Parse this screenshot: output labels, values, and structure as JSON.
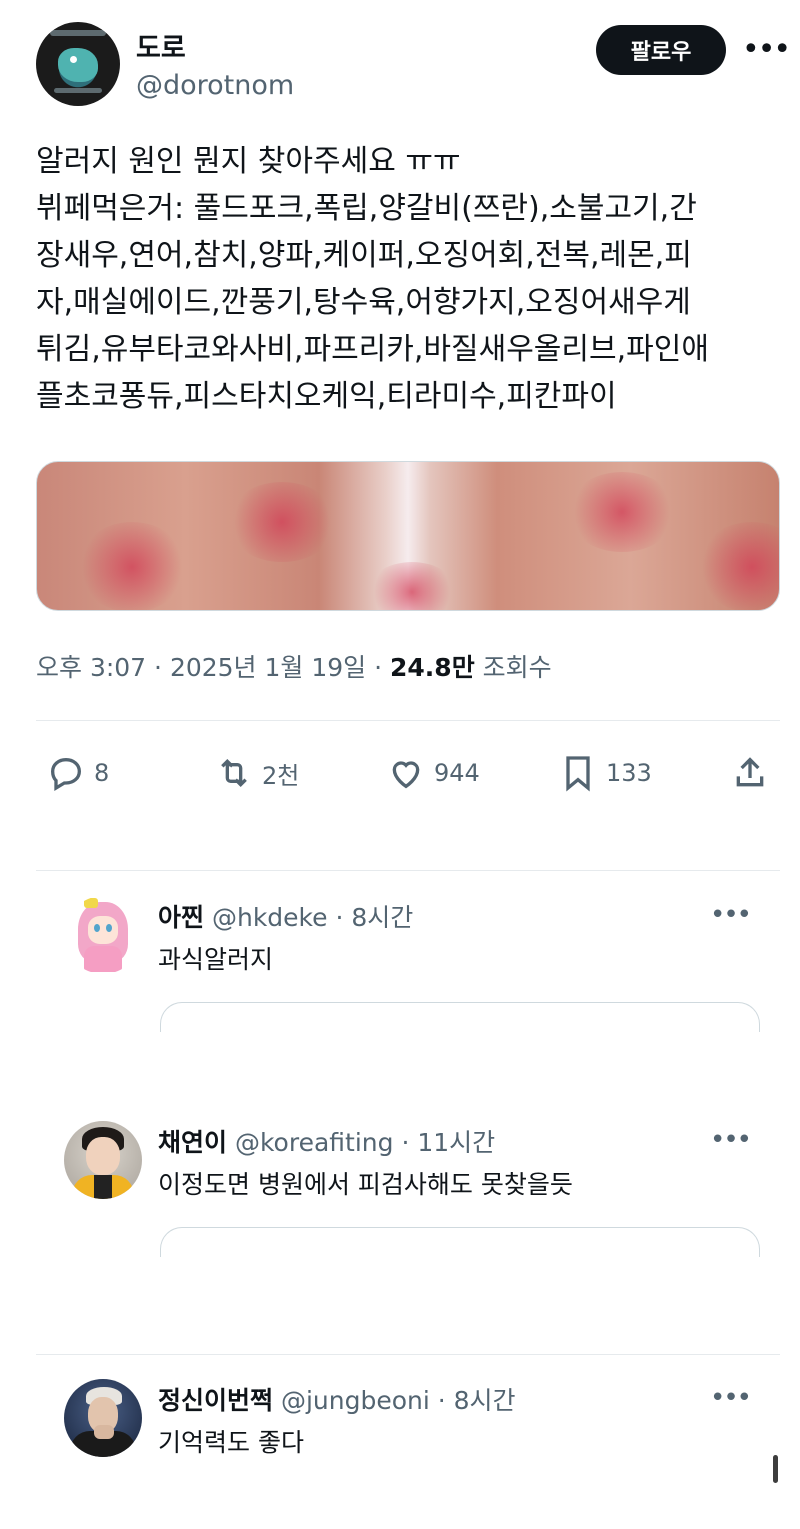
{
  "tweet": {
    "author_name": "도로",
    "author_handle": "@dorotnom",
    "follow_label": "팔로우",
    "more_label": "•••",
    "lines": [
      "알러지 원인 뭔지 찾아주세요 ㅠㅠ",
      "뷔페먹은거: 풀드포크,폭립,양갈비(쯔란),소불고기,간",
      "장새우,연어,참치,양파,케이퍼,오징어회,전복,레몬,피",
      "자,매실에이드,깐풍기,탕수육,어향가지,오징어새우게",
      "튀김,유부타코와사비,파프리카,바질새우올리브,파인애",
      "플초코퐁듀,피스타치오케익,티라미수,피칸파이"
    ],
    "time": "오후 3:07",
    "date": "2025년 1월 19일",
    "views_count": "24.8만",
    "views_label": "조회수",
    "separator": " · "
  },
  "actions": {
    "reply_count": "8",
    "retweet_count": "2천",
    "like_count": "944",
    "bookmark_count": "133"
  },
  "replies": [
    {
      "name": "아찐",
      "handle": "@hkdeke",
      "time": "8시간",
      "text": "과식알러지"
    },
    {
      "name": "채연이",
      "handle": "@koreafiting",
      "time": "11시간",
      "text": "이정도면 병원에서 피검사해도 못찾을듯"
    },
    {
      "name": "정신이번쩍",
      "handle": "@jungbeoni",
      "time": "8시간",
      "text": "기억력도 좋다"
    }
  ],
  "colors": {
    "text_primary": "#0f1419",
    "text_secondary": "#536471",
    "divider": "#e6eaed"
  },
  "icons": [
    "reply-icon",
    "retweet-icon",
    "like-icon",
    "bookmark-icon",
    "share-icon",
    "more-icon"
  ]
}
